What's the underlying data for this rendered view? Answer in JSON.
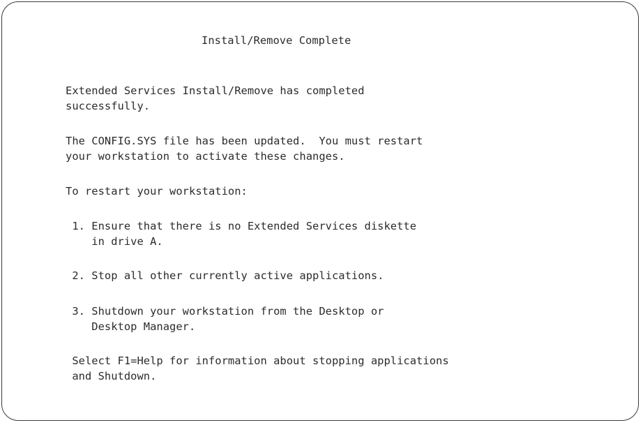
{
  "dialog": {
    "title": "Install/Remove Complete",
    "completion_line1": "Extended Services Install/Remove has completed",
    "completion_line2": "successfully.",
    "config_line1": "The CONFIG.SYS file has been updated.  You must restart",
    "config_line2": "your workstation to activate these changes.",
    "restart_heading": "To restart your workstation:",
    "steps": [
      {
        "line1": " 1. Ensure that there is no Extended Services diskette",
        "line2": "    in drive A."
      },
      {
        "line1": " 2. Stop all other currently active applications."
      },
      {
        "line1": " 3. Shutdown your workstation from the Desktop or",
        "line2": "    Desktop Manager."
      }
    ],
    "help_line1": " Select F1=Help for information about stopping applications",
    "help_line2": " and Shutdown."
  }
}
